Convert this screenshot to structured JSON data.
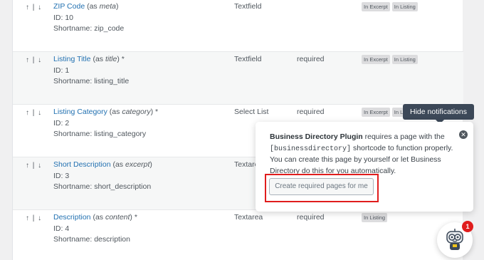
{
  "fields": [
    {
      "order": "↑ | ↓",
      "name": "ZIP Code",
      "as_prefix": "(as ",
      "as_value": "meta",
      "as_suffix": ")",
      "required_mark": "",
      "id": "ID: 10",
      "shortname": "Shortname: zip_code",
      "type": "Textfield",
      "required": "",
      "tags": [
        "In Excerpt",
        "In Listing"
      ]
    },
    {
      "order": "↑ | ↓",
      "name": "Listing Title",
      "as_prefix": "(as ",
      "as_value": "title",
      "as_suffix": ")",
      "required_mark": " *",
      "id": "ID: 1",
      "shortname": "Shortname: listing_title",
      "type": "Textfield",
      "required": "required",
      "tags": [
        "In Excerpt",
        "In Listing"
      ]
    },
    {
      "order": "↑ | ↓",
      "name": "Listing Category",
      "as_prefix": "(as ",
      "as_value": "category",
      "as_suffix": ")",
      "required_mark": " *",
      "id": "ID: 2",
      "shortname": "Shortname: listing_category",
      "type": "Select List",
      "required": "required",
      "tags": [
        "In Excerpt",
        "In List"
      ]
    },
    {
      "order": "↑ | ↓",
      "name": "Short Description",
      "as_prefix": "(as ",
      "as_value": "excerpt",
      "as_suffix": ")",
      "required_mark": "",
      "id": "ID: 3",
      "shortname": "Shortname: short_description",
      "type": "Textare",
      "required": "",
      "tags": []
    },
    {
      "order": "↑ | ↓",
      "name": "Description",
      "as_prefix": "(as ",
      "as_value": "content",
      "as_suffix": ")",
      "required_mark": " *",
      "id": "ID: 4",
      "shortname": "Shortname: description",
      "type": "Textarea",
      "required": "required",
      "tags": [
        "In Listing"
      ]
    }
  ],
  "hide_notifications": "Hide notifications",
  "notification": {
    "plugin_name": "Business Directory Plugin",
    "text_1": " requires a page with the ",
    "shortcode": "[businessdirectory]",
    "text_2": " shortcode to function properly. You can create this page by yourself or let Business Directory do this for you automatically.",
    "close_glyph": "✕",
    "button": "Create required pages for me"
  },
  "chat_badge": "1",
  "colors": {
    "link": "#2271b1",
    "highlight": "#e01d1d",
    "tooltip_bg": "#3c4858"
  }
}
